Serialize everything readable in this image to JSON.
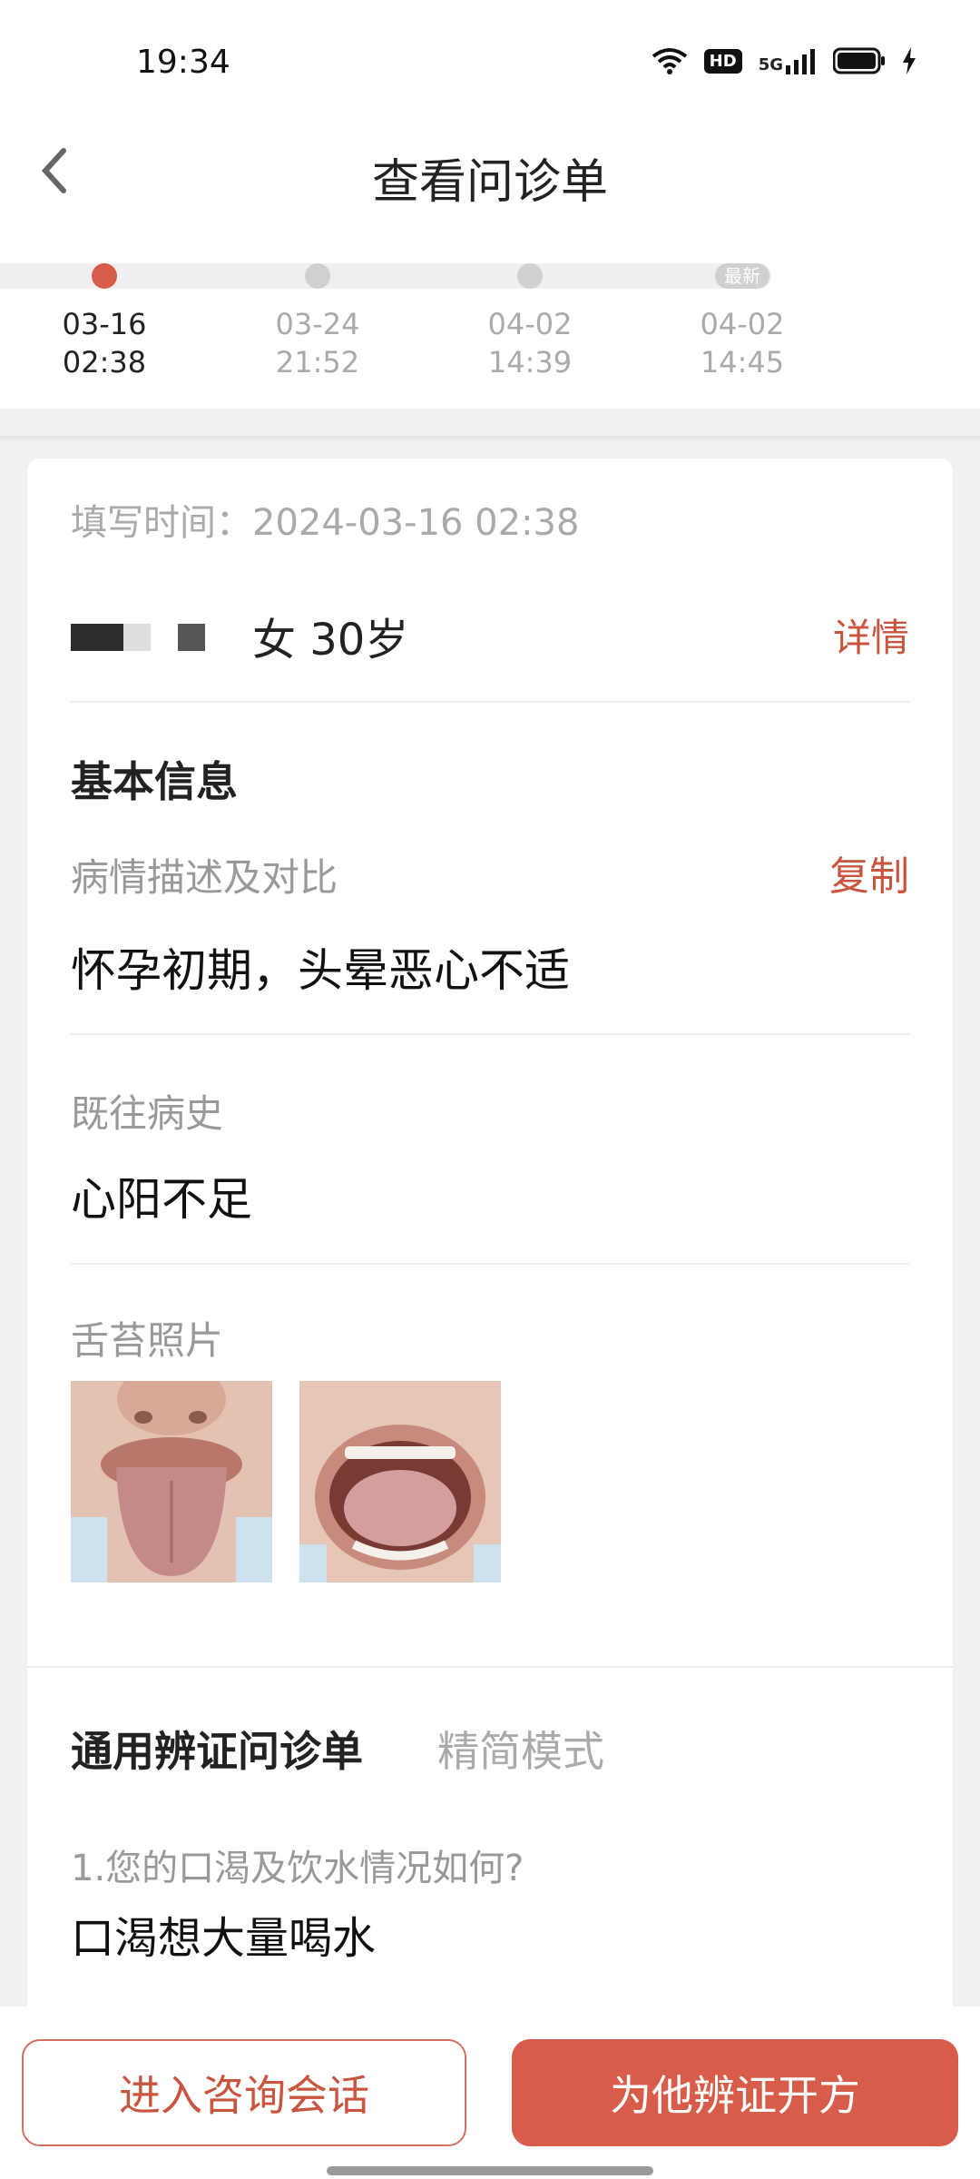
{
  "status_bar": {
    "time": "19:34",
    "icons": [
      "wifi-icon",
      "hd-icon",
      "5g-signal-icon",
      "battery-icon",
      "charging-icon"
    ],
    "hd_label": "HD",
    "network_label": "5G"
  },
  "header": {
    "title": "查看问诊单",
    "back_icon": "back-icon"
  },
  "timeline": {
    "items": [
      {
        "date": "03-16",
        "time": "02:38",
        "active": true,
        "badge": ""
      },
      {
        "date": "03-24",
        "time": "21:52",
        "active": false,
        "badge": ""
      },
      {
        "date": "04-02",
        "time": "14:39",
        "active": false,
        "badge": ""
      },
      {
        "date": "04-02",
        "time": "14:45",
        "active": false,
        "badge": "最新"
      }
    ]
  },
  "record": {
    "fill_time_label": "填写时间：",
    "fill_time_value": "2024-03-16 02:38",
    "patient_gender_age": "女 30岁",
    "detail_link": "详情",
    "basic_info_title": "基本信息",
    "condition_label": "病情描述及对比",
    "copy_link": "复制",
    "condition_value": "怀孕初期，头晕恶心不适",
    "history_label": "既往病史",
    "history_value": "心阳不足",
    "tongue_photo_label": "舌苔照片",
    "photos": [
      "tongue-photo-1",
      "tongue-photo-2"
    ]
  },
  "questionnaire": {
    "tab_main": "通用辨证问诊单",
    "tab_alt": "精简模式",
    "question_1": "1.您的口渴及饮水情况如何?",
    "answer_1": "口渴想大量喝水"
  },
  "actions": {
    "consult_button": "进入咨询会话",
    "prescribe_button": "为他辨证开方"
  },
  "colors": {
    "accent": "#d85c4a",
    "link": "#c9553f",
    "background": "#f1f1f1"
  }
}
